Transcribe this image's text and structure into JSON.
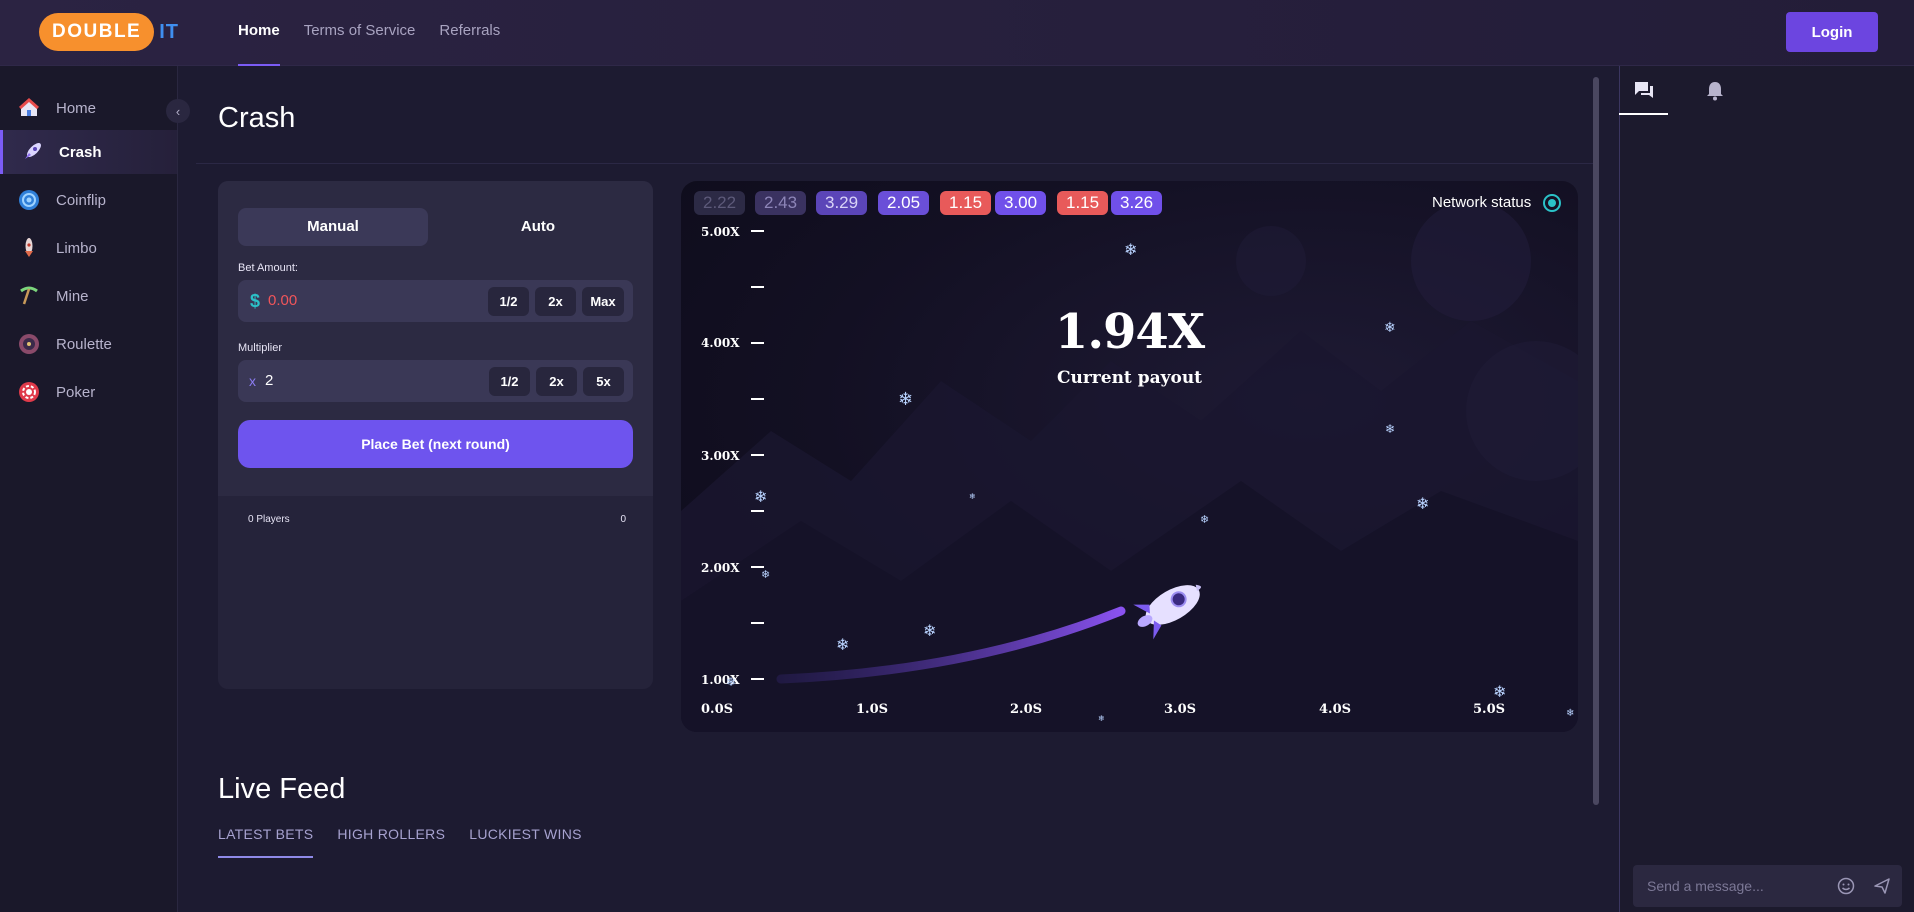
{
  "brand": {
    "logo_main": "DOUBLE",
    "logo_suffix": "IT"
  },
  "topnav": [
    {
      "label": "Home",
      "active": true
    },
    {
      "label": "Terms of Service",
      "active": false
    },
    {
      "label": "Referrals",
      "active": false
    }
  ],
  "login_label": "Login",
  "sidebar": {
    "items": [
      {
        "label": "Home",
        "icon": "house-icon",
        "active": false
      },
      {
        "label": "Crash",
        "icon": "rocket-icon",
        "active": true
      },
      {
        "label": "Coinflip",
        "icon": "coin-icon",
        "active": false
      },
      {
        "label": "Limbo",
        "icon": "rocket-small-icon",
        "active": false
      },
      {
        "label": "Mine",
        "icon": "pickaxe-icon",
        "active": false
      },
      {
        "label": "Roulette",
        "icon": "roulette-wheel-icon",
        "active": false
      },
      {
        "label": "Poker",
        "icon": "poker-chip-icon",
        "active": false
      }
    ]
  },
  "page_title": "Crash",
  "bet_panel": {
    "tabs": [
      {
        "label": "Manual",
        "active": true
      },
      {
        "label": "Auto",
        "active": false
      }
    ],
    "bet_amount": {
      "label": "Bet Amount:",
      "currency_symbol": "$",
      "value": "0.00",
      "buttons": [
        "1/2",
        "2x",
        "Max"
      ]
    },
    "multiplier": {
      "label": "Multiplier",
      "prefix": "x",
      "value": "2",
      "buttons": [
        "1/2",
        "2x",
        "5x"
      ]
    },
    "place_bet_label": "Place Bet (next round)",
    "players_label": "0 Players",
    "players_total": "0"
  },
  "game": {
    "history": [
      {
        "value": "2.22",
        "color": "#2c2a45",
        "text_color": "#5d5a7a"
      },
      {
        "value": "2.43",
        "color": "#3a3260",
        "text_color": "#8d85b8"
      },
      {
        "value": "3.29",
        "color": "#5b45b8",
        "text_color": "#d9d3f7"
      },
      {
        "value": "2.05",
        "color": "#6a4fd8",
        "text_color": "#ffffff"
      },
      {
        "value": "1.15",
        "color": "#e85a5a",
        "text_color": "#ffffff"
      },
      {
        "value": "3.00",
        "color": "#7050ea",
        "text_color": "#ffffff"
      },
      {
        "value": "1.15",
        "color": "#e85a5a",
        "text_color": "#ffffff"
      },
      {
        "value": "3.26",
        "color": "#7050ea",
        "text_color": "#ffffff"
      }
    ],
    "network_status_label": "Network status",
    "current_payout": "1.94X",
    "current_payout_label": "Current payout",
    "y_axis": [
      "5.00X",
      "4.00X",
      "3.00X",
      "2.00X",
      "1.00X"
    ],
    "x_axis": [
      "0.0S",
      "1.0S",
      "2.0S",
      "3.0S",
      "4.0S",
      "5.0S"
    ]
  },
  "live_feed": {
    "title": "Live Feed",
    "tabs": [
      {
        "label": "LATEST BETS",
        "active": true
      },
      {
        "label": "HIGH ROLLERS",
        "active": false
      },
      {
        "label": "LUCKIEST WINS",
        "active": false
      }
    ]
  },
  "chat": {
    "placeholder": "Send a message..."
  },
  "colors": {
    "accent": "#6e54ee",
    "brand_orange": "#f7902d",
    "brand_blue": "#3f8ff0",
    "currency_teal": "#2bc2c8",
    "bet_value_red": "#f0555a"
  }
}
